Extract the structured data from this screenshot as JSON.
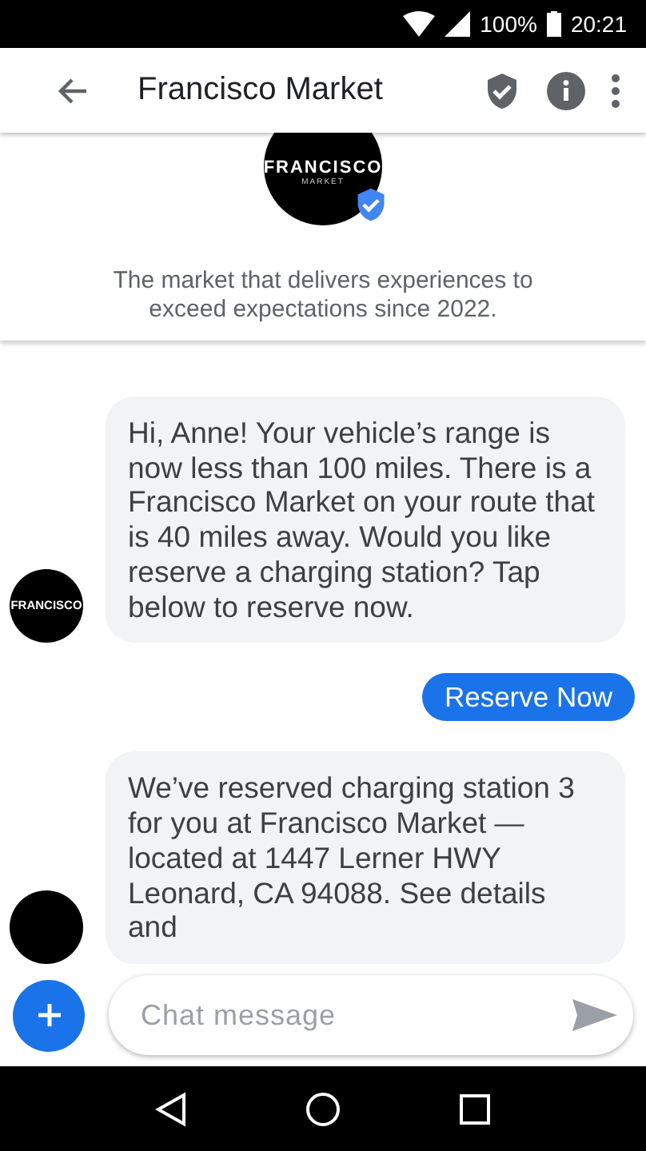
{
  "status_bar": {
    "battery": "100%",
    "time": "20:21"
  },
  "app_bar": {
    "title": "Francisco Market"
  },
  "profile": {
    "logo": {
      "name": "FRANCISCO",
      "sub": "MARKET"
    },
    "verified": true,
    "description": "The market that delivers experiences to exceed expectations since 2022."
  },
  "messages": [
    {
      "kind": "incoming",
      "text": "Hi, Anne! Your vehicle’s range is now less than 100 miles. There is a Francisco Market on your route that is 40 miles away. Would you like reserve a charging station? Tap below to reserve now.",
      "avatar": {
        "name": "FRANCISCO"
      }
    },
    {
      "kind": "action",
      "text": "Reserve Now"
    },
    {
      "kind": "incoming",
      "text": "We’ve reserved charging station 3 for you at Francisco Market —located at 1447 Lerner HWY Leonard, CA 94088. See details and"
    }
  ],
  "composer": {
    "placeholder": "Chat message"
  }
}
